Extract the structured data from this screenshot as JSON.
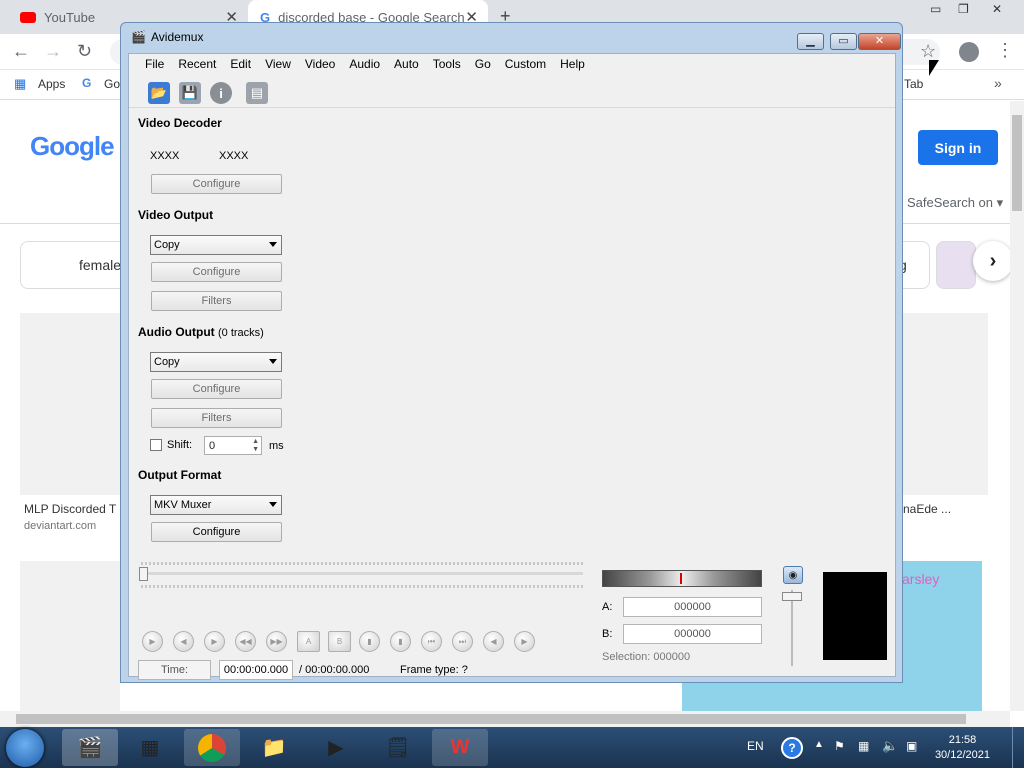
{
  "browser": {
    "tabs": [
      {
        "label": "YouTube"
      },
      {
        "label": "discorded base - Google Search"
      }
    ],
    "bookmarks": {
      "apps": "Apps",
      "google": "Go",
      "other": "Tab"
    }
  },
  "google": {
    "logo": "Google",
    "signin": "Sign in",
    "safesearch": "SafeSearch on",
    "chip_left": "female",
    "chip_right": "g",
    "result_left_title": "MLP Discorded T",
    "result_left_source": "deviantart.com",
    "result_right_title": "naEde ...",
    "image_overlay": "arsley"
  },
  "avidemux": {
    "title": "Avidemux",
    "menu": [
      "File",
      "Recent",
      "Edit",
      "View",
      "Video",
      "Audio",
      "Auto",
      "Tools",
      "Go",
      "Custom",
      "Help"
    ],
    "video_decoder": {
      "label": "Video Decoder",
      "left": "XXXX",
      "right": "XXXX",
      "configure": "Configure"
    },
    "video_output": {
      "label": "Video Output",
      "codec": "Copy",
      "configure": "Configure",
      "filters": "Filters"
    },
    "audio_output": {
      "label": "Audio Output",
      "tracks": "(0 tracks)",
      "codec": "Copy",
      "configure": "Configure",
      "filters": "Filters",
      "shift_label": "Shift:",
      "shift_value": "0",
      "shift_unit": "ms"
    },
    "output_format": {
      "label": "Output Format",
      "muxer": "MKV Muxer",
      "configure": "Configure"
    },
    "time": {
      "label": "Time:",
      "current": "00:00:00.000",
      "total": "/ 00:00:00.000",
      "frame_type": "Frame type:  ?"
    },
    "markers": {
      "a_label": "A:",
      "a_value": "000000",
      "b_label": "B:",
      "b_value": "000000",
      "selection": "Selection: 000000"
    }
  },
  "taskbar": {
    "lang": "EN",
    "time": "21:58",
    "date": "30/12/2021"
  }
}
